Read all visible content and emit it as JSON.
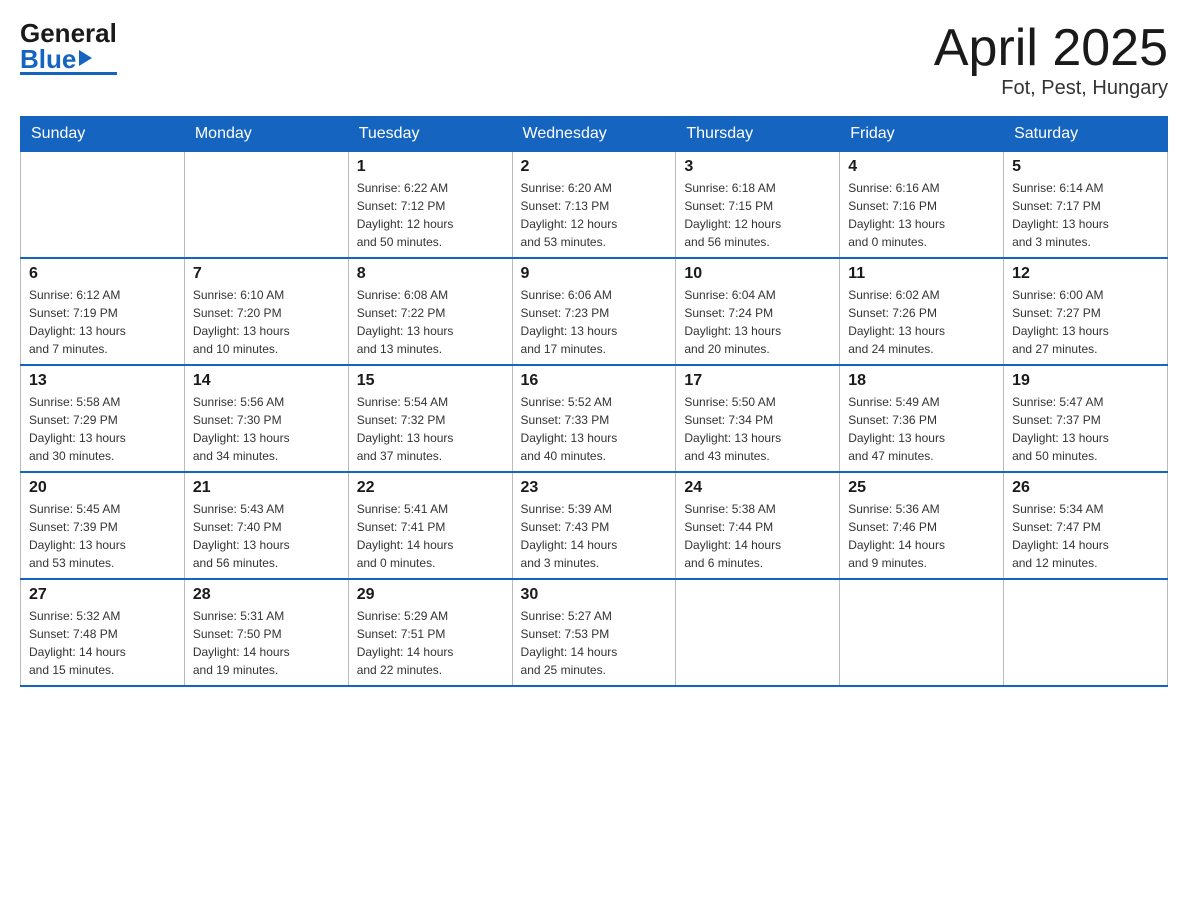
{
  "header": {
    "logo_general": "General",
    "logo_blue": "Blue",
    "month_year": "April 2025",
    "location": "Fot, Pest, Hungary"
  },
  "weekdays": [
    "Sunday",
    "Monday",
    "Tuesday",
    "Wednesday",
    "Thursday",
    "Friday",
    "Saturday"
  ],
  "weeks": [
    [
      {
        "day": "",
        "info": ""
      },
      {
        "day": "",
        "info": ""
      },
      {
        "day": "1",
        "info": "Sunrise: 6:22 AM\nSunset: 7:12 PM\nDaylight: 12 hours\nand 50 minutes."
      },
      {
        "day": "2",
        "info": "Sunrise: 6:20 AM\nSunset: 7:13 PM\nDaylight: 12 hours\nand 53 minutes."
      },
      {
        "day": "3",
        "info": "Sunrise: 6:18 AM\nSunset: 7:15 PM\nDaylight: 12 hours\nand 56 minutes."
      },
      {
        "day": "4",
        "info": "Sunrise: 6:16 AM\nSunset: 7:16 PM\nDaylight: 13 hours\nand 0 minutes."
      },
      {
        "day": "5",
        "info": "Sunrise: 6:14 AM\nSunset: 7:17 PM\nDaylight: 13 hours\nand 3 minutes."
      }
    ],
    [
      {
        "day": "6",
        "info": "Sunrise: 6:12 AM\nSunset: 7:19 PM\nDaylight: 13 hours\nand 7 minutes."
      },
      {
        "day": "7",
        "info": "Sunrise: 6:10 AM\nSunset: 7:20 PM\nDaylight: 13 hours\nand 10 minutes."
      },
      {
        "day": "8",
        "info": "Sunrise: 6:08 AM\nSunset: 7:22 PM\nDaylight: 13 hours\nand 13 minutes."
      },
      {
        "day": "9",
        "info": "Sunrise: 6:06 AM\nSunset: 7:23 PM\nDaylight: 13 hours\nand 17 minutes."
      },
      {
        "day": "10",
        "info": "Sunrise: 6:04 AM\nSunset: 7:24 PM\nDaylight: 13 hours\nand 20 minutes."
      },
      {
        "day": "11",
        "info": "Sunrise: 6:02 AM\nSunset: 7:26 PM\nDaylight: 13 hours\nand 24 minutes."
      },
      {
        "day": "12",
        "info": "Sunrise: 6:00 AM\nSunset: 7:27 PM\nDaylight: 13 hours\nand 27 minutes."
      }
    ],
    [
      {
        "day": "13",
        "info": "Sunrise: 5:58 AM\nSunset: 7:29 PM\nDaylight: 13 hours\nand 30 minutes."
      },
      {
        "day": "14",
        "info": "Sunrise: 5:56 AM\nSunset: 7:30 PM\nDaylight: 13 hours\nand 34 minutes."
      },
      {
        "day": "15",
        "info": "Sunrise: 5:54 AM\nSunset: 7:32 PM\nDaylight: 13 hours\nand 37 minutes."
      },
      {
        "day": "16",
        "info": "Sunrise: 5:52 AM\nSunset: 7:33 PM\nDaylight: 13 hours\nand 40 minutes."
      },
      {
        "day": "17",
        "info": "Sunrise: 5:50 AM\nSunset: 7:34 PM\nDaylight: 13 hours\nand 43 minutes."
      },
      {
        "day": "18",
        "info": "Sunrise: 5:49 AM\nSunset: 7:36 PM\nDaylight: 13 hours\nand 47 minutes."
      },
      {
        "day": "19",
        "info": "Sunrise: 5:47 AM\nSunset: 7:37 PM\nDaylight: 13 hours\nand 50 minutes."
      }
    ],
    [
      {
        "day": "20",
        "info": "Sunrise: 5:45 AM\nSunset: 7:39 PM\nDaylight: 13 hours\nand 53 minutes."
      },
      {
        "day": "21",
        "info": "Sunrise: 5:43 AM\nSunset: 7:40 PM\nDaylight: 13 hours\nand 56 minutes."
      },
      {
        "day": "22",
        "info": "Sunrise: 5:41 AM\nSunset: 7:41 PM\nDaylight: 14 hours\nand 0 minutes."
      },
      {
        "day": "23",
        "info": "Sunrise: 5:39 AM\nSunset: 7:43 PM\nDaylight: 14 hours\nand 3 minutes."
      },
      {
        "day": "24",
        "info": "Sunrise: 5:38 AM\nSunset: 7:44 PM\nDaylight: 14 hours\nand 6 minutes."
      },
      {
        "day": "25",
        "info": "Sunrise: 5:36 AM\nSunset: 7:46 PM\nDaylight: 14 hours\nand 9 minutes."
      },
      {
        "day": "26",
        "info": "Sunrise: 5:34 AM\nSunset: 7:47 PM\nDaylight: 14 hours\nand 12 minutes."
      }
    ],
    [
      {
        "day": "27",
        "info": "Sunrise: 5:32 AM\nSunset: 7:48 PM\nDaylight: 14 hours\nand 15 minutes."
      },
      {
        "day": "28",
        "info": "Sunrise: 5:31 AM\nSunset: 7:50 PM\nDaylight: 14 hours\nand 19 minutes."
      },
      {
        "day": "29",
        "info": "Sunrise: 5:29 AM\nSunset: 7:51 PM\nDaylight: 14 hours\nand 22 minutes."
      },
      {
        "day": "30",
        "info": "Sunrise: 5:27 AM\nSunset: 7:53 PM\nDaylight: 14 hours\nand 25 minutes."
      },
      {
        "day": "",
        "info": ""
      },
      {
        "day": "",
        "info": ""
      },
      {
        "day": "",
        "info": ""
      }
    ]
  ]
}
